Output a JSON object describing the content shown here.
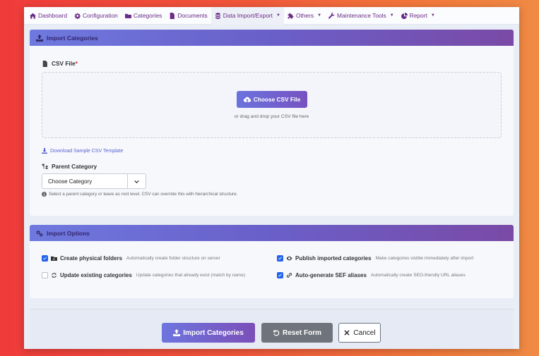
{
  "nav": {
    "items": [
      {
        "label": "Dashboard",
        "icon": "home-icon"
      },
      {
        "label": "Configuration",
        "icon": "gear-icon"
      },
      {
        "label": "Categories",
        "icon": "folder-icon"
      },
      {
        "label": "Documents",
        "icon": "document-icon"
      },
      {
        "label": "Data Import/Export",
        "icon": "database-icon",
        "dropdown": true,
        "active": true
      },
      {
        "label": "Others",
        "icon": "puzzle-icon",
        "dropdown": true
      },
      {
        "label": "Maintenance Tools",
        "icon": "wrench-icon",
        "dropdown": true
      },
      {
        "label": "Report",
        "icon": "chart-pie-icon",
        "dropdown": true
      }
    ]
  },
  "import_card": {
    "title": "Import Categories",
    "csv_label": "CSV File",
    "required_mark": "*",
    "choose_button": "Choose CSV File",
    "drop_hint": "or drag and drop your CSV file here",
    "download_link": "Download Sample CSV Template",
    "parent_label": "Parent Category",
    "parent_select_value": "Choose Category",
    "parent_help": "Select a parent category or leave as root level. CSV can override this with hierarchical structure."
  },
  "options_card": {
    "title": "Import Options",
    "options": [
      {
        "name": "Create physical folders",
        "desc": "Automatically create folder structure on server",
        "checked": true,
        "icon": "folder-plus-icon"
      },
      {
        "name": "Publish imported categories",
        "desc": "Make categories visible immediately after import",
        "checked": true,
        "icon": "eye-icon"
      },
      {
        "name": "Update existing categories",
        "desc": "Update categories that already exist (match by name)",
        "checked": false,
        "icon": "sync-icon"
      },
      {
        "name": "Auto-generate SEF aliases",
        "desc": "Automatically create SEO-friendly URL aliases",
        "checked": true,
        "icon": "link-icon"
      }
    ]
  },
  "footer": {
    "import_button": "Import Categories",
    "reset_button": "Reset Form",
    "cancel_button": "Cancel"
  },
  "colors": {
    "accent_start": "#6e79de",
    "accent_end": "#7a4aa6",
    "checkbox": "#2563eb",
    "nav_text": "#6a2a86"
  }
}
